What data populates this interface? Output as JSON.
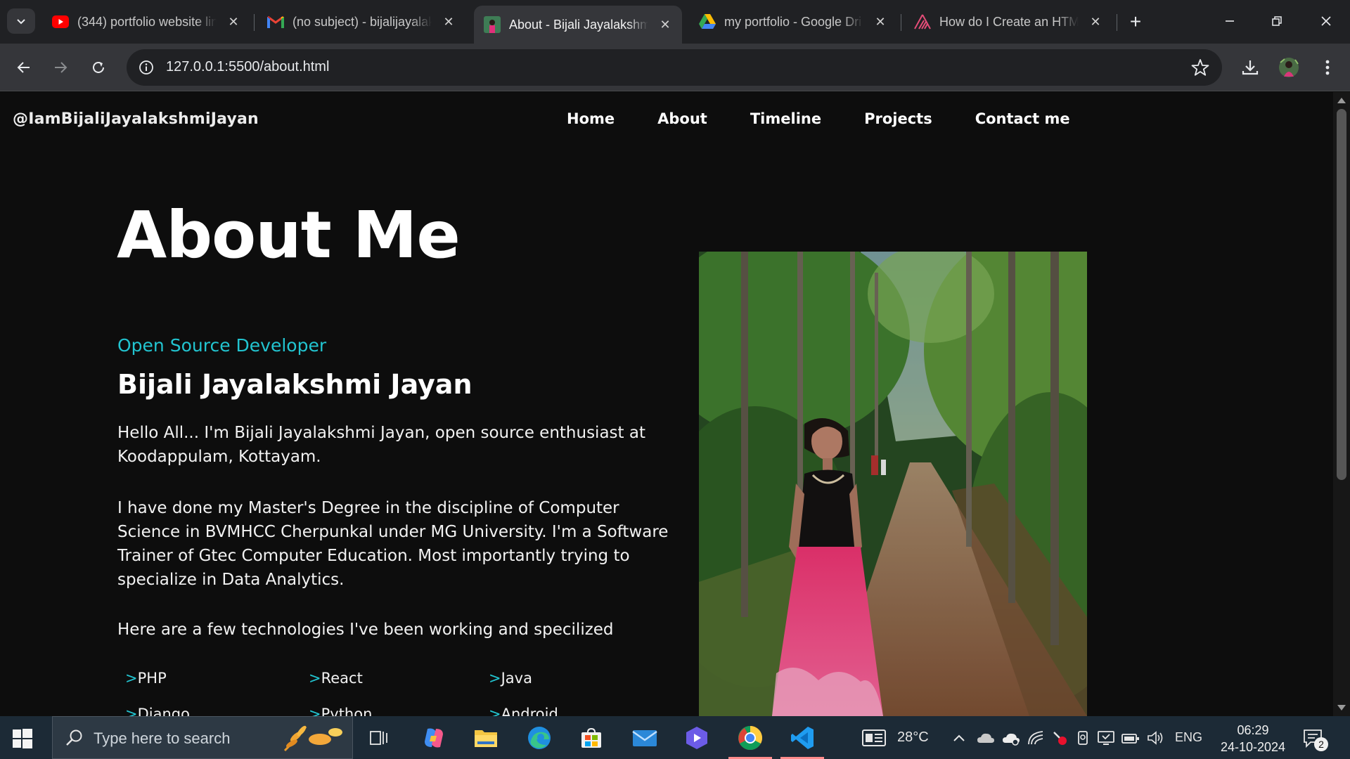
{
  "browser": {
    "tabs": [
      {
        "title": "(344) portfolio website lin",
        "icon": "youtube-icon"
      },
      {
        "title": "(no subject) - bijalijayalak",
        "icon": "gmail-icon"
      },
      {
        "title": "About - Bijali Jayalakshm",
        "icon": "site-favicon",
        "active": true
      },
      {
        "title": "my portfolio - Google Dri",
        "icon": "google-drive-icon"
      },
      {
        "title": "How do I Create an HTM",
        "icon": "website-favicon"
      }
    ],
    "close_glyph": "✕",
    "new_tab_glyph": "+",
    "url": "127.0.0.1:5500/about.html"
  },
  "site": {
    "brand": "@IamBijaliJayalakshmiJayan",
    "nav": [
      "Home",
      "About",
      "Timeline",
      "Projects",
      "Contact me"
    ],
    "page_title": "About Me",
    "role": "Open Source Developer",
    "name": "Bijali Jayalakshmi Jayan",
    "intro": "Hello All... I'm Bijali Jayalakshmi Jayan, open source enthusiast at Koodappulam, Kottayam.",
    "education": "I have done my Master's Degree in the discipline of Computer Science in BVMHCC Cherpunkal under MG University. I'm a Software Trainer of Gtec Computer Education. Most importantly trying to specialize in Data Analytics.",
    "tech_intro": "Here are a few technologies I've been working and specilized",
    "tech_marker": ">",
    "technologies": [
      "PHP",
      "React",
      "Java",
      "Django",
      "Python",
      "Android"
    ],
    "accent_color": "#22c4d0"
  },
  "taskbar": {
    "search_placeholder": "Type here to search",
    "weather": "28°C",
    "language": "ENG",
    "time": "06:29",
    "date": "24-10-2024",
    "notification_count": "2"
  }
}
